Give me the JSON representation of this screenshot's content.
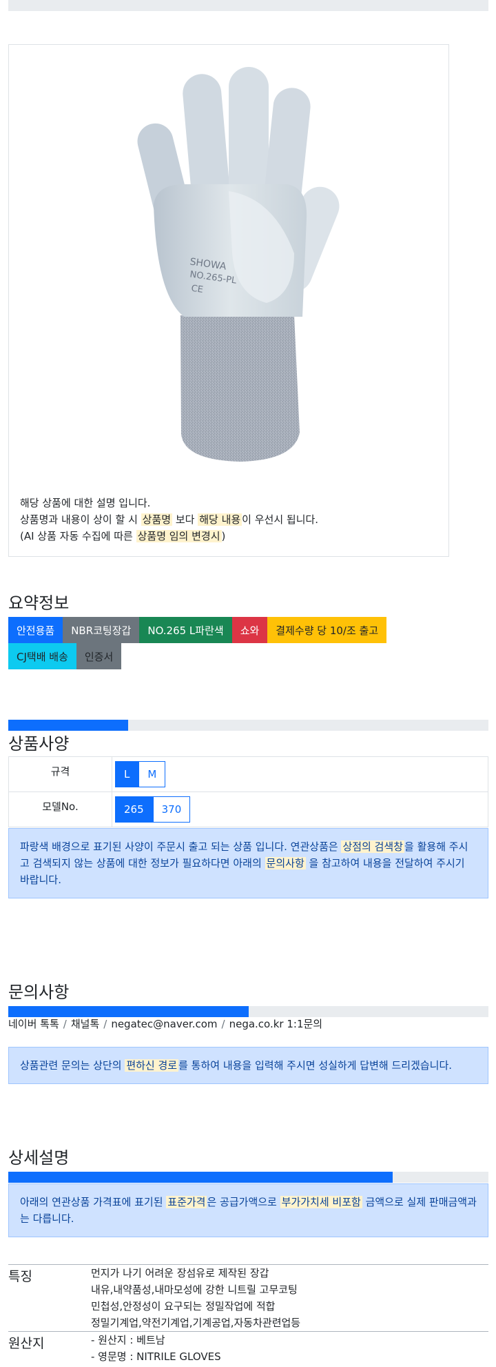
{
  "product_card": {
    "image_text": {
      "brand": "SHOWA",
      "model": "NO.265-PL",
      "mark": "CE"
    },
    "desc_line1": "해당 상품에 대한 설명 입니다.",
    "desc_line2_a": "상품명과 내용이 상이 할 시 ",
    "desc_line2_hl1": "상품명",
    "desc_line2_b": " 보다 ",
    "desc_line2_hl2": "해당 내용",
    "desc_line2_c": "이 우선시 됩니다.",
    "desc_line3_a": "(AI 상품 자동 수집에 따른 ",
    "desc_line3_hl": "상품명 임의 변경시",
    "desc_line3_b": ")"
  },
  "summary": {
    "title": "요약정보",
    "badges": [
      {
        "label": "안전용품",
        "color": "#0d6efd",
        "text_color": "#ffffff"
      },
      {
        "label": "NBR코팅장갑",
        "color": "#6c757d",
        "text_color": "#ffffff"
      },
      {
        "label": "NO.265 L파란색",
        "color": "#198754",
        "text_color": "#ffffff"
      },
      {
        "label": "쇼와",
        "color": "#dc3545",
        "text_color": "#ffffff"
      },
      {
        "label": "결제수량 당 10/조 출고",
        "color": "#ffc107",
        "text_color": "#212529"
      },
      {
        "label": "CJ택배 배송",
        "color": "#0dcaf0",
        "text_color": "#212529"
      },
      {
        "label": "인증서",
        "color": "#6c757d",
        "text_color": "#212529"
      }
    ]
  },
  "specs": {
    "title": "상품사양",
    "progress": 0.25,
    "rows": [
      {
        "label": "규격",
        "options": [
          "L",
          "M"
        ],
        "selected": "L"
      },
      {
        "label": "모델No.",
        "options": [
          "265",
          "370"
        ],
        "selected": "265"
      }
    ],
    "notice_a": "파랑색 배경으로 표기된 사양이 주문시 출고 되는 상품 입니다. 연관상품은 ",
    "notice_hl1": "상점의 검색창",
    "notice_b": "을 활용해 주시고 검색되지 않는 상품에 대한 정보가 필요하다면 아래의 ",
    "notice_hl2": "문의사항",
    "notice_c": " 을 참고하여 내용을 전달하여 주시기 바랍니다."
  },
  "inquiry": {
    "title": "문의사항",
    "progress": 0.5,
    "contacts": [
      "네이버 톡톡",
      "채널톡",
      "negatec@naver.com",
      "nega.co.kr 1:1문의"
    ],
    "notice_a": "상품관련 문의는 상단의 ",
    "notice_hl": "편하신 경로",
    "notice_b": "를 통하여 내용을 입력해 주시면 성실하게 답변해 드리겠습니다."
  },
  "detail": {
    "title": "상세설명",
    "progress": 0.8,
    "notice_a": "아래의 연관상품 가격표에 표기된 ",
    "notice_hl1": "표준가격",
    "notice_b": "은 공급가액으로 ",
    "notice_hl2": "부가가치세 비포함",
    "notice_c": " 금액으로 실제 판매금액과는 다릅니다.",
    "features_key": "특징",
    "features": [
      "먼지가 나기 어려운 장섬유로 제작된 장갑",
      "내유,내약품성,내마모성에 강한 니트릴 고무코팅",
      "민첩성,안정성이 요구되는 정밀작업에 적합",
      "정밀기계업,약전기계업,기계공업,자동차관련업등"
    ],
    "origin_key": "원산지",
    "origin": [
      "- 원산지 : 베트남",
      "- 영문명 : NITRILE GLOVES"
    ]
  }
}
